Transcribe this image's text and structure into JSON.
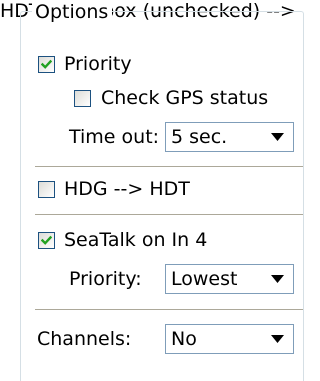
{
  "options_group": {
    "legend": "Options",
    "priority": {
      "label": "Priority",
      "checked": true
    },
    "check_gps": {
      "label": "Check GPS status",
      "checked": false
    },
    "timeout": {
      "label": "Time out:",
      "value": "5 sec."
    },
    "hdg_hdt": {
      "label": "HDG --> HDT",
      "checked": false
    },
    "seatalk": {
      "label": "SeaTalk on In 4",
      "checked": true
    },
    "seatalk_priority": {
      "label": "Priority:",
      "value": "Lowest"
    },
    "channels": {
      "label": "Channels:",
      "value": "No"
    }
  },
  "icons": {
    "check": "checkmark-icon",
    "dropdown": "chevron-down-icon"
  },
  "colors": {
    "checkmark": "#21a121",
    "checkbox_border": "#1c5180",
    "group_border": "#d5dfe5",
    "combo_border": "#7f9db9",
    "separator": "#aca899"
  }
}
